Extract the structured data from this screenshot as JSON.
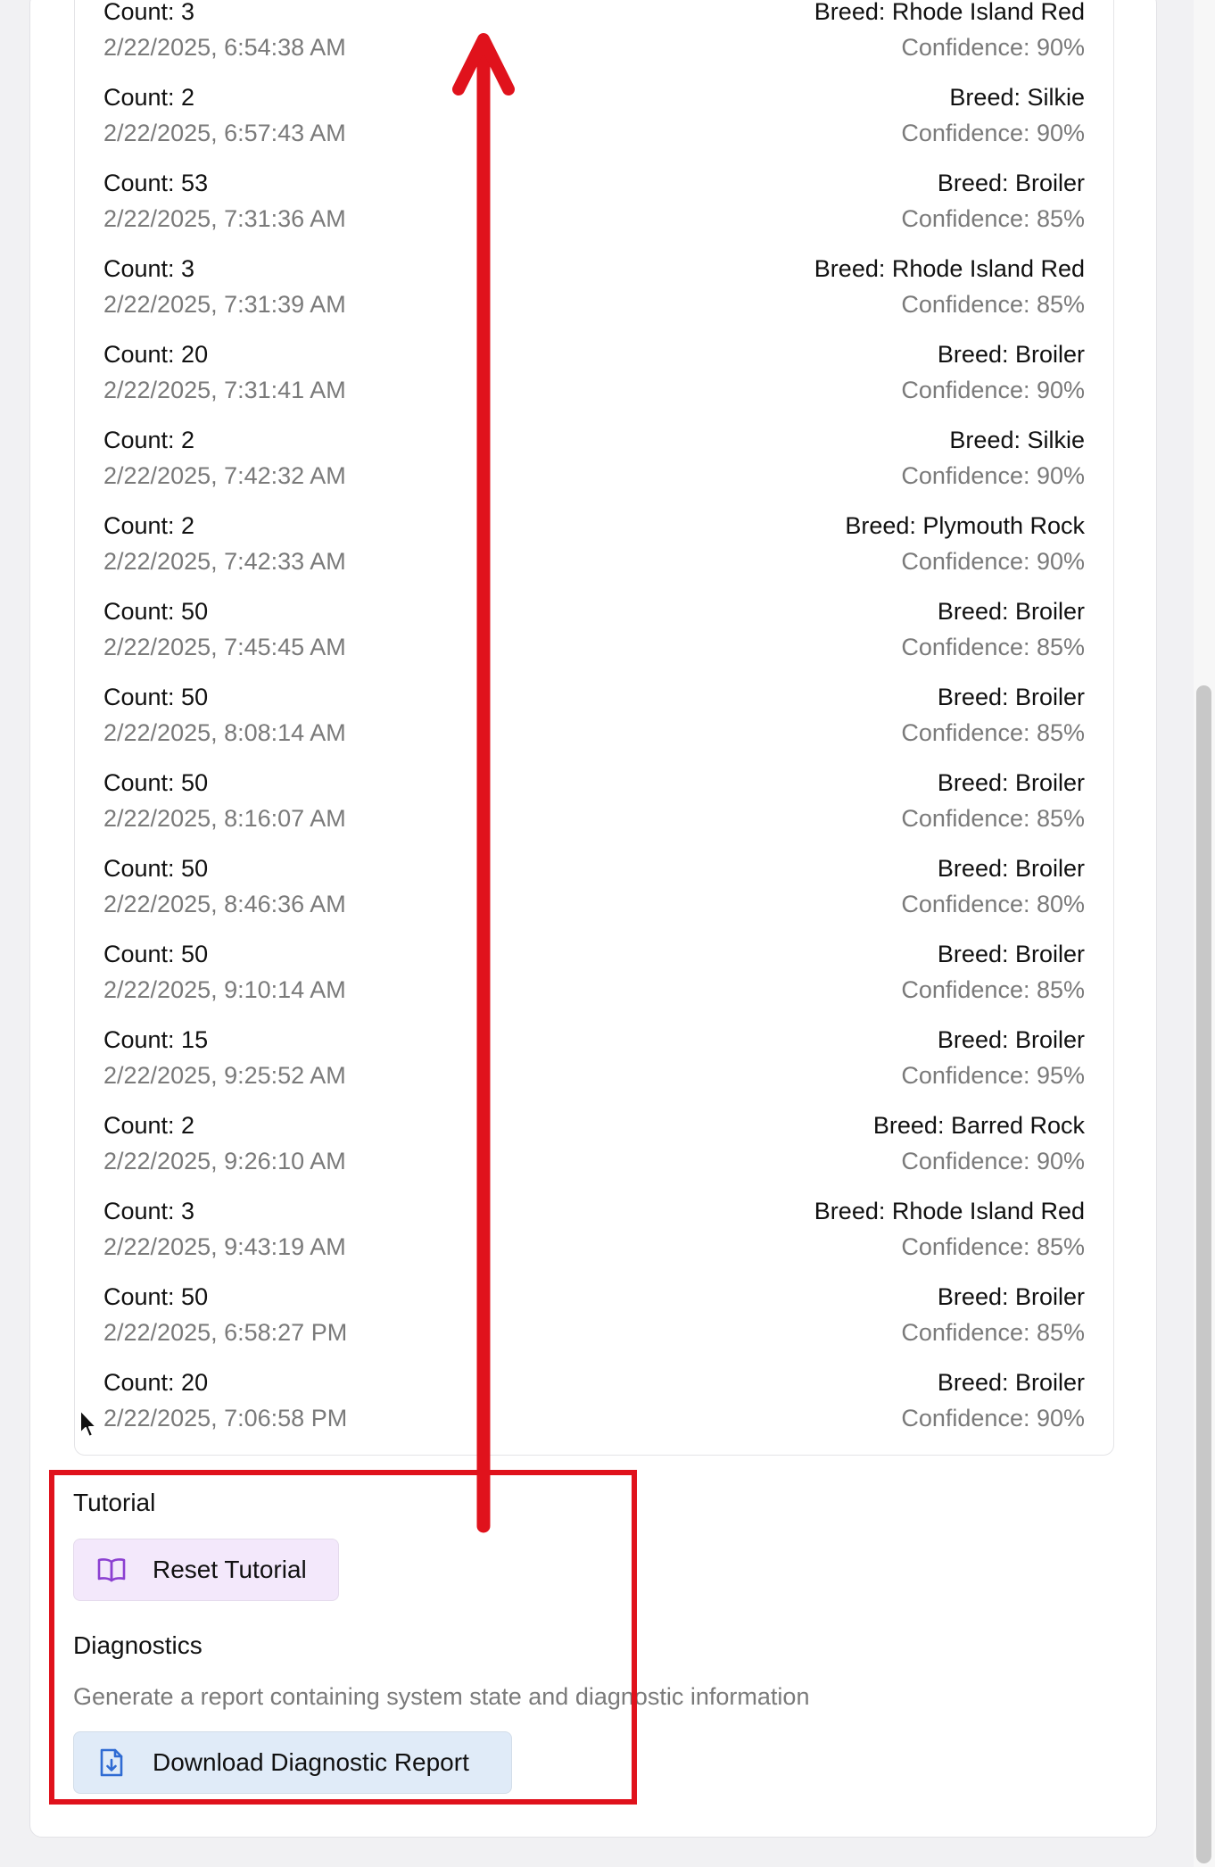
{
  "history": {
    "entries": [
      {
        "count": "Count: 3",
        "time": "2/22/2025, 6:54:38 AM",
        "breed": "Breed: Rhode Island Red",
        "confidence": "Confidence: 90%"
      },
      {
        "count": "Count: 2",
        "time": "2/22/2025, 6:57:43 AM",
        "breed": "Breed: Silkie",
        "confidence": "Confidence: 90%"
      },
      {
        "count": "Count: 53",
        "time": "2/22/2025, 7:31:36 AM",
        "breed": "Breed: Broiler",
        "confidence": "Confidence: 85%"
      },
      {
        "count": "Count: 3",
        "time": "2/22/2025, 7:31:39 AM",
        "breed": "Breed: Rhode Island Red",
        "confidence": "Confidence: 85%"
      },
      {
        "count": "Count: 20",
        "time": "2/22/2025, 7:31:41 AM",
        "breed": "Breed: Broiler",
        "confidence": "Confidence: 90%"
      },
      {
        "count": "Count: 2",
        "time": "2/22/2025, 7:42:32 AM",
        "breed": "Breed: Silkie",
        "confidence": "Confidence: 90%"
      },
      {
        "count": "Count: 2",
        "time": "2/22/2025, 7:42:33 AM",
        "breed": "Breed: Plymouth Rock",
        "confidence": "Confidence: 90%"
      },
      {
        "count": "Count: 50",
        "time": "2/22/2025, 7:45:45 AM",
        "breed": "Breed: Broiler",
        "confidence": "Confidence: 85%"
      },
      {
        "count": "Count: 50",
        "time": "2/22/2025, 8:08:14 AM",
        "breed": "Breed: Broiler",
        "confidence": "Confidence: 85%"
      },
      {
        "count": "Count: 50",
        "time": "2/22/2025, 8:16:07 AM",
        "breed": "Breed: Broiler",
        "confidence": "Confidence: 85%"
      },
      {
        "count": "Count: 50",
        "time": "2/22/2025, 8:46:36 AM",
        "breed": "Breed: Broiler",
        "confidence": "Confidence: 80%"
      },
      {
        "count": "Count: 50",
        "time": "2/22/2025, 9:10:14 AM",
        "breed": "Breed: Broiler",
        "confidence": "Confidence: 85%"
      },
      {
        "count": "Count: 15",
        "time": "2/22/2025, 9:25:52 AM",
        "breed": "Breed: Broiler",
        "confidence": "Confidence: 95%"
      },
      {
        "count": "Count: 2",
        "time": "2/22/2025, 9:26:10 AM",
        "breed": "Breed: Barred Rock",
        "confidence": "Confidence: 90%"
      },
      {
        "count": "Count: 3",
        "time": "2/22/2025, 9:43:19 AM",
        "breed": "Breed: Rhode Island Red",
        "confidence": "Confidence: 85%"
      },
      {
        "count": "Count: 50",
        "time": "2/22/2025, 6:58:27 PM",
        "breed": "Breed: Broiler",
        "confidence": "Confidence: 85%"
      },
      {
        "count": "Count: 20",
        "time": "2/22/2025, 7:06:58 PM",
        "breed": "Breed: Broiler",
        "confidence": "Confidence: 90%"
      }
    ]
  },
  "tutorial": {
    "title": "Tutorial",
    "reset_label": "Reset Tutorial",
    "icon": "book-open-icon"
  },
  "diagnostics": {
    "title": "Diagnostics",
    "description": "Generate a report containing system state and diagnostic information",
    "download_label": "Download Diagnostic Report",
    "icon": "file-download-icon"
  },
  "colors": {
    "annotation": "#e0121c",
    "reset_button_bg": "#f3e8fb",
    "reset_icon": "#8b3fd1",
    "download_button_bg": "#e0ebf8",
    "download_icon": "#2f6bd3"
  }
}
